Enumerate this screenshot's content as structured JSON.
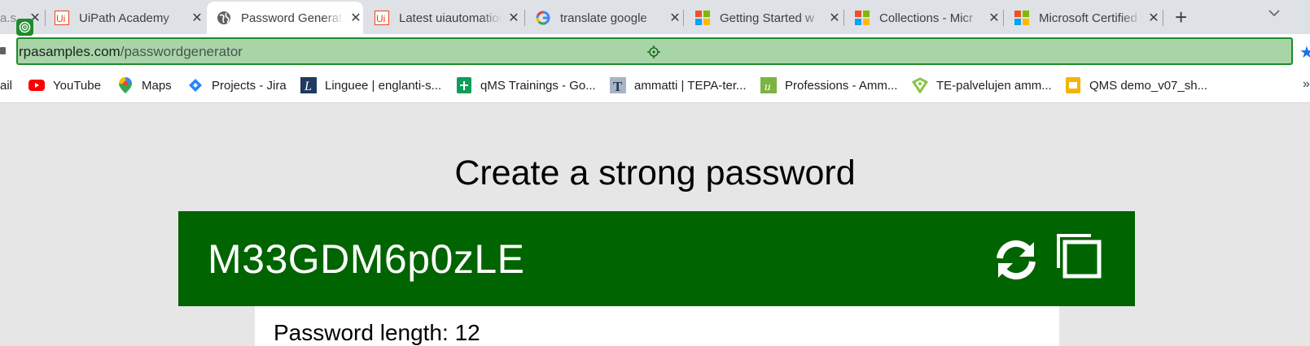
{
  "browser": {
    "tabs": [
      {
        "title": "a.s",
        "favicon": "partial-icon",
        "active": false
      },
      {
        "title": "UiPath Academy",
        "favicon": "uipath-icon",
        "active": false
      },
      {
        "title": "Password Generator",
        "favicon": "globe-icon",
        "active": true
      },
      {
        "title": "Latest uiautomation",
        "favicon": "uipath-icon",
        "active": false
      },
      {
        "title": "translate google",
        "favicon": "google-icon",
        "active": false
      },
      {
        "title": "Getting Started w",
        "favicon": "microsoft-icon",
        "active": false
      },
      {
        "title": "Collections - Micr",
        "favicon": "microsoft-icon",
        "active": false
      },
      {
        "title": "Microsoft Certified",
        "favicon": "microsoft-icon",
        "active": false
      }
    ],
    "address": {
      "domain": "rpasamples.com",
      "path": "/passwordgenerator"
    },
    "bookmarks": [
      {
        "label": "ail",
        "icon": "gmail-icon"
      },
      {
        "label": "YouTube",
        "icon": "youtube-icon"
      },
      {
        "label": "Maps",
        "icon": "maps-icon"
      },
      {
        "label": "Projects - Jira",
        "icon": "jira-icon"
      },
      {
        "label": "Linguee | englanti-s...",
        "icon": "linguee-icon"
      },
      {
        "label": "qMS Trainings - Go...",
        "icon": "google-sheets-icon"
      },
      {
        "label": "ammatti | TEPA-ter...",
        "icon": "tepa-icon"
      },
      {
        "label": "Professions - Amm...",
        "icon": "professions-icon"
      },
      {
        "label": "TE-palvelujen amm...",
        "icon": "te-icon"
      },
      {
        "label": "QMS demo_v07_sh...",
        "icon": "google-slides-icon"
      }
    ],
    "bookmarks_overflow": "»"
  },
  "page": {
    "heading": "Create a strong password",
    "password": "M33GDM6p0zLE",
    "length_label": "Password length:",
    "length_value": "12"
  },
  "colors": {
    "panel_green": "#006400",
    "omnibox_highlight": "#a8d5a8",
    "highlight_border": "#1e8b2b"
  }
}
